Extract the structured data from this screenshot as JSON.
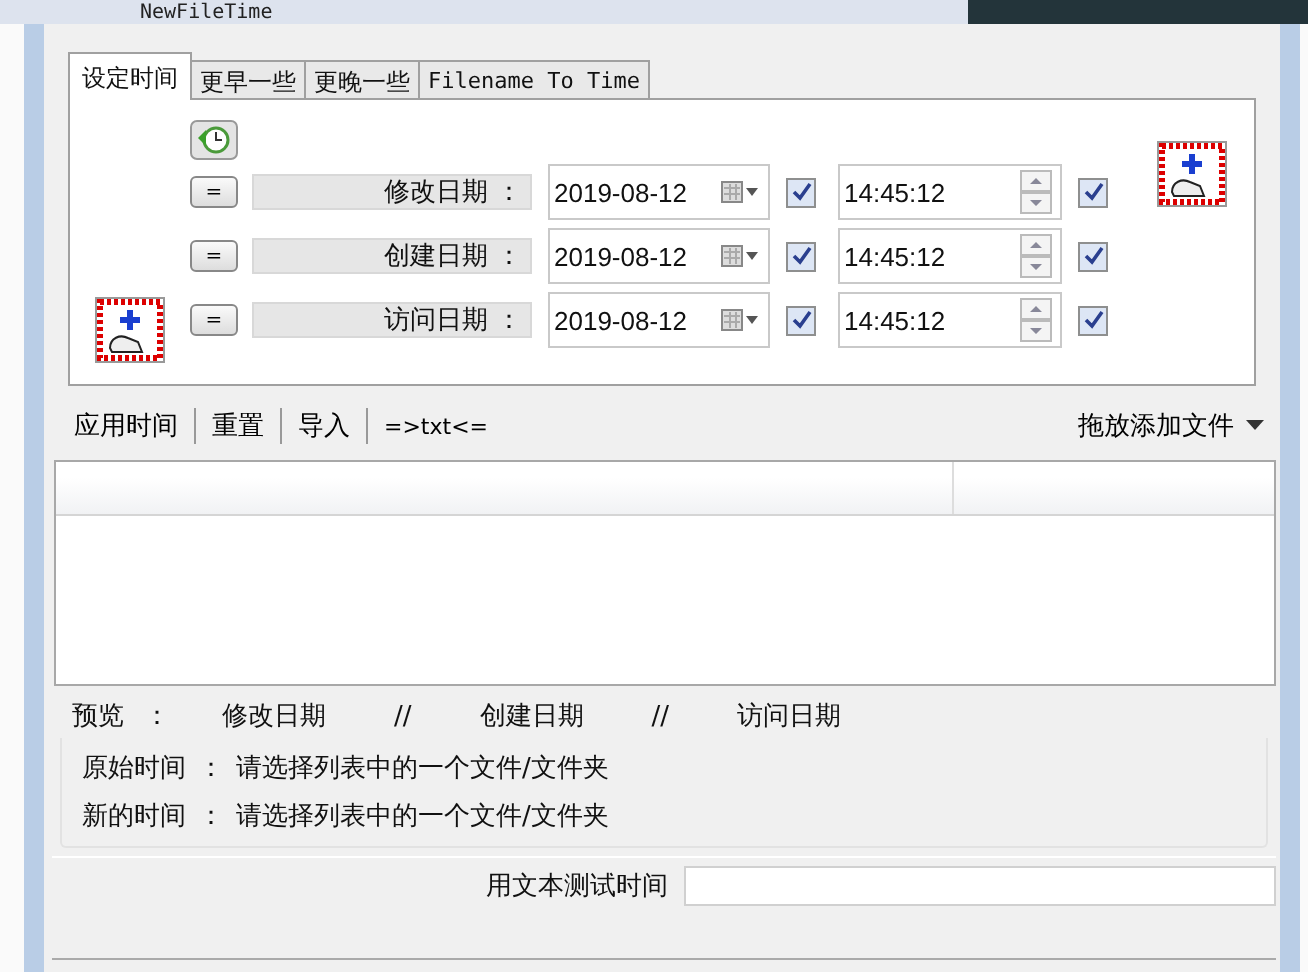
{
  "window": {
    "title": "NewFileTime"
  },
  "tabs": [
    {
      "label": "设定时间",
      "selected": true
    },
    {
      "label": "更早一些",
      "selected": false
    },
    {
      "label": "更晚一些",
      "selected": false
    },
    {
      "label": "Filename To Time",
      "selected": false
    }
  ],
  "date_rows": [
    {
      "button": "=",
      "label": "修改日期",
      "separator": "：",
      "date": "2019-08-12",
      "date_enabled": true,
      "time": "14:45:12",
      "time_enabled": true
    },
    {
      "button": "=",
      "label": "创建日期",
      "separator": "：",
      "date": "2019-08-12",
      "date_enabled": true,
      "time": "14:45:12",
      "time_enabled": true
    },
    {
      "button": "=",
      "label": "访问日期",
      "separator": "：",
      "date": "2019-08-12",
      "date_enabled": true,
      "time": "14:45:12",
      "time_enabled": true
    }
  ],
  "toolbar": {
    "buttons": [
      "应用时间",
      "重置",
      "导入",
      "=>txt<="
    ],
    "drop_menu": "拖放添加文件"
  },
  "preview": {
    "label": "预览",
    "separator": "：",
    "columns": [
      "修改日期",
      "//",
      "创建日期",
      "//",
      "访问日期"
    ]
  },
  "info": [
    {
      "label": "原始时间",
      "separator": "：",
      "value": "请选择列表中的一个文件/文件夹"
    },
    {
      "label": "新的时间",
      "separator": "：",
      "value": "请选择列表中的一个文件/文件夹"
    }
  ],
  "test": {
    "label": "用文本测试时间"
  }
}
